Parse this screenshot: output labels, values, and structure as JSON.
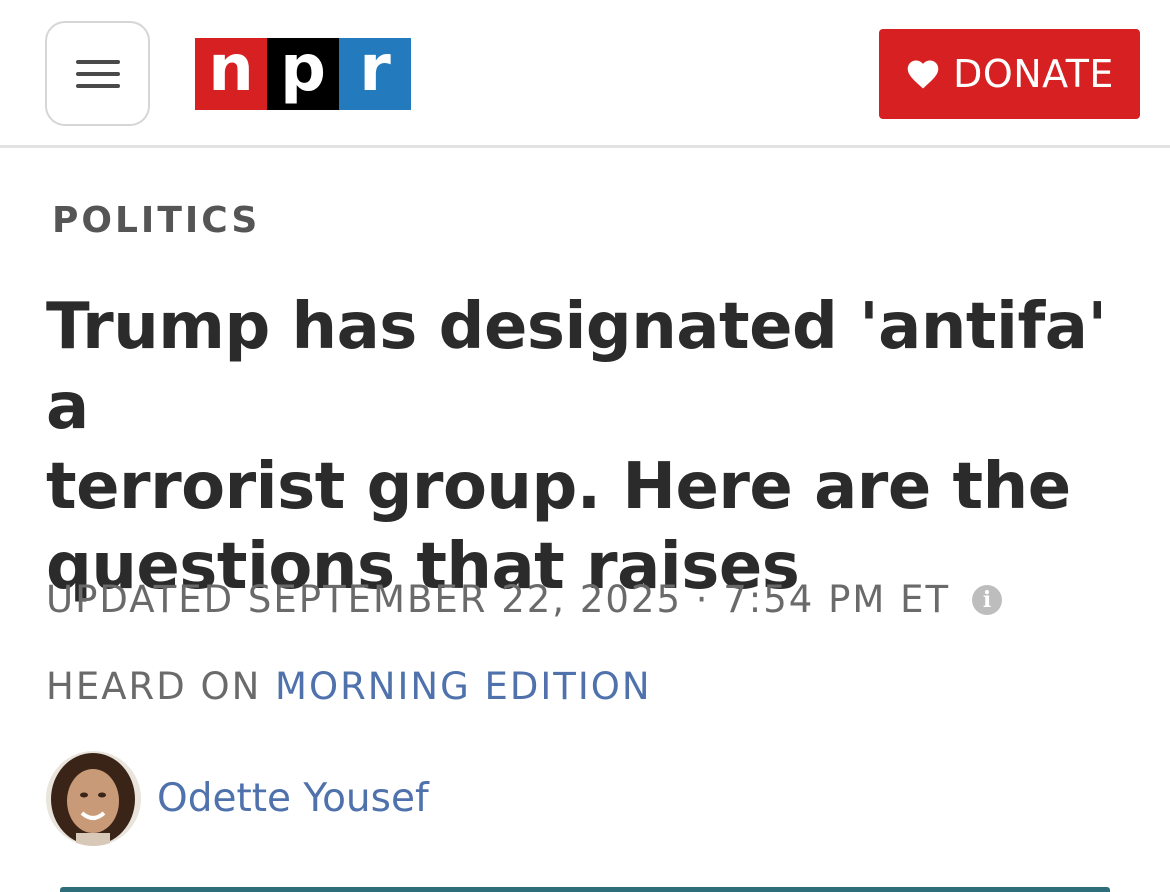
{
  "header": {
    "logo": {
      "letters": [
        "n",
        "p",
        "r"
      ],
      "colors": [
        "#d62021",
        "#000000",
        "#237bbd"
      ]
    },
    "donate": {
      "label": "DONATE",
      "icon": "heart-icon",
      "color": "#d62021"
    },
    "menu": {
      "icon": "hamburger-menu-icon"
    }
  },
  "article": {
    "section": "POLITICS",
    "headline_lines": [
      "Trump has designated 'antifa' a",
      "terrorist group. Here are the",
      "questions that raises"
    ],
    "updated": "UPDATED SEPTEMBER 22, 2025 · 7:54 PM ET",
    "heard_on_prefix": "HEARD ON",
    "program": "MORNING EDITION",
    "author": "Odette Yousef",
    "link_color": "#4f72ad"
  }
}
